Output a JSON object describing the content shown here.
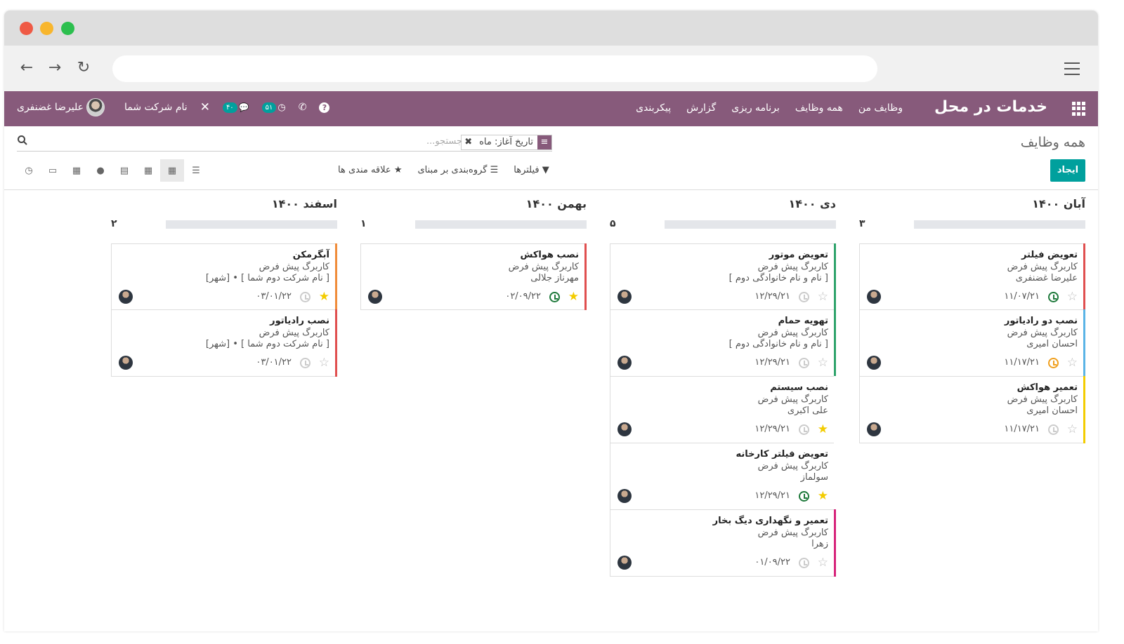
{
  "app": {
    "name": "خدمات در محل"
  },
  "menu": [
    "وظایف من",
    "همه وظایف",
    "برنامه ریزی",
    "گزارش",
    "پیکربندی"
  ],
  "systray": {
    "company": "نام شرکت شما",
    "user": "علیرضا غضنفری",
    "activity_count": "۵۱",
    "message_count": "۴۰"
  },
  "breadcrumb": "همه وظایف",
  "search": {
    "facet": "تاریخ آغاز: ماه",
    "placeholder": "جستجو..."
  },
  "create_label": "ایجاد",
  "filters": {
    "filters": "فیلترها",
    "groupby": "گروه‌بندی بر مبنای",
    "favorites": "علاقه مندی ها"
  },
  "colors": {
    "brand": "#875a7b",
    "accent": "#00a09d",
    "star": "#f3cc00"
  },
  "columns": [
    {
      "title": "آبان ۱۴۰۰",
      "count": "۳",
      "cards": [
        {
          "title": "تعویض فیلتر",
          "line1": "کاربرگ پیش فرض",
          "line2": "علیرضا غضنفری",
          "date": "۱۱/۰۷/۲۱",
          "starred": false,
          "clock": "#1f7a3c",
          "stripe": "#e04f4f"
        },
        {
          "title": "نصب دو رادیاتور",
          "line1": "کاربرگ پیش فرض",
          "line2": "احسان امیری",
          "date": "۱۱/۱۷/۲۱",
          "starred": false,
          "clock": "#f0a01f",
          "stripe": "#5ab4e6"
        },
        {
          "title": "تعمیر هواکش",
          "line1": "کاربرگ پیش فرض",
          "line2": "احسان امیری",
          "date": "۱۱/۱۷/۲۱",
          "starred": false,
          "clock": "#cccccc",
          "stripe": "#f3cc00"
        }
      ]
    },
    {
      "title": "دی ۱۴۰۰",
      "count": "۵",
      "cards": [
        {
          "title": "تعویض موتور",
          "line1": "کاربرگ پیش فرض",
          "line2": "[ نام و نام خانوادگی دوم ]",
          "date": "۱۲/۲۹/۲۱",
          "starred": false,
          "clock": "#cccccc",
          "stripe": "#2ea36b"
        },
        {
          "title": "تهویه حمام",
          "line1": "کاربرگ پیش فرض",
          "line2": "[ نام و نام خانوادگی دوم ]",
          "date": "۱۲/۲۹/۲۱",
          "starred": false,
          "clock": "#cccccc",
          "stripe": "#2ea36b"
        },
        {
          "title": "نصب سیستم",
          "line1": "کاربرگ پیش فرض",
          "line2": "علی اکبری",
          "date": "۱۲/۲۹/۲۱",
          "starred": true,
          "clock": "#cccccc",
          "stripe": "#ffffff"
        },
        {
          "title": "تعویض فیلتر کارخانه",
          "line1": "کاربرگ پیش فرض",
          "line2": "سولماز",
          "date": "۱۲/۲۹/۲۱",
          "starred": true,
          "clock": "#1f7a3c",
          "stripe": "#ffffff"
        },
        {
          "title": "تعمیر و نگهداری دیگ بخار",
          "line1": "کاربرگ پیش فرض",
          "line2": "زهرا",
          "date": "۰۱/۰۹/۲۲",
          "starred": false,
          "clock": "#cccccc",
          "stripe": "#d6237a"
        }
      ]
    },
    {
      "title": "بهمن ۱۴۰۰",
      "count": "۱",
      "cards": [
        {
          "title": "نصب هواکش",
          "line1": "کاربرگ پیش فرض",
          "line2": "مهرناز جلالی",
          "date": "۰۲/۰۹/۲۲",
          "starred": true,
          "clock": "#1f7a3c",
          "stripe": "#e04f4f"
        }
      ]
    },
    {
      "title": "اسفند ۱۴۰۰",
      "count": "۲",
      "cards": [
        {
          "title": "آبگرمکن",
          "line1": "کاربرگ پیش فرض",
          "line2": "[ نام شرکت دوم شما ] • [شهر]",
          "date": "۰۳/۰۱/۲۲",
          "starred": true,
          "clock": "#cccccc",
          "stripe": "#f08c3a"
        },
        {
          "title": "نصب رادیاتور",
          "line1": "کاربرگ پیش فرض",
          "line2": "[ نام شرکت دوم شما ] • [شهر]",
          "date": "۰۳/۰۱/۲۲",
          "starred": false,
          "clock": "#cccccc",
          "stripe": "#e04f4f"
        }
      ]
    }
  ]
}
